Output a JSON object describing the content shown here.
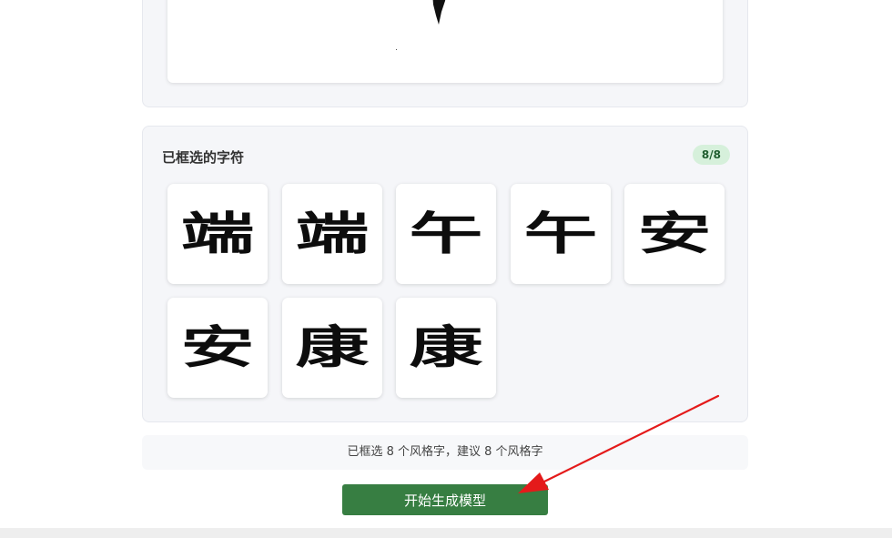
{
  "selected_panel": {
    "title": "已框选的字符",
    "count_badge": "8/8",
    "characters": [
      "端",
      "端",
      "午",
      "午",
      "安",
      "安",
      "康",
      "康"
    ]
  },
  "summary": {
    "text": "已框选 8 个风格字，建议 8 个风格字"
  },
  "start_button": {
    "label": "开始生成模型",
    "color": "#377e42"
  },
  "annotation": {
    "arrow_color": "#e41a1a"
  }
}
